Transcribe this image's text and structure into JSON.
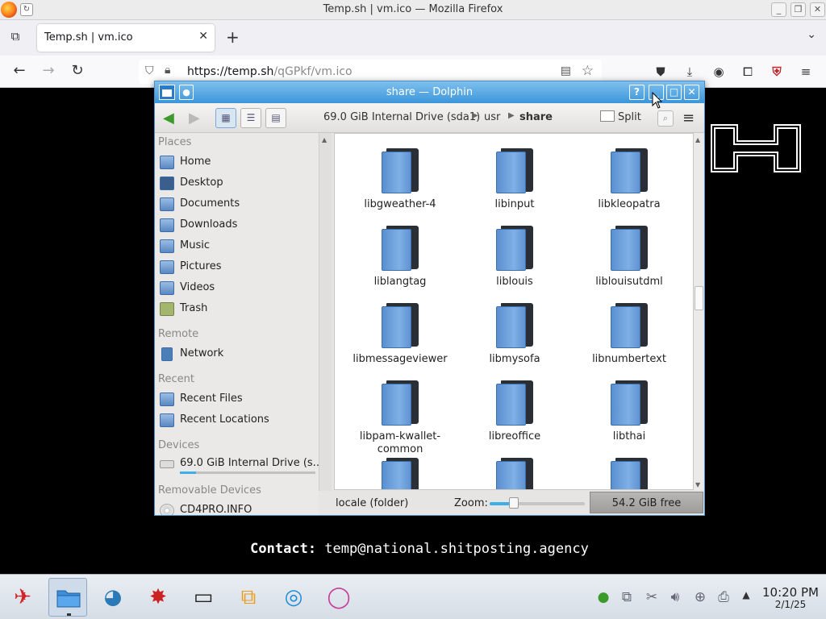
{
  "firefox": {
    "window_title": "Temp.sh | vm.ico — Mozilla Firefox",
    "tab_title": "Temp.sh | vm.ico",
    "url_domain": "https://temp.sh",
    "url_path": "/qGPkf/vm.ico"
  },
  "page": {
    "contact_label": "Contact:",
    "contact_email": "temp@national.shitposting.agency"
  },
  "dolphin": {
    "title": "share — Dolphin",
    "breadcrumbs": [
      "69.0 GiB Internal Drive (sda1)",
      "usr",
      "share"
    ],
    "split_label": "Split",
    "places": {
      "places_header": "Places",
      "home": "Home",
      "desktop": "Desktop",
      "documents": "Documents",
      "downloads": "Downloads",
      "music": "Music",
      "pictures": "Pictures",
      "videos": "Videos",
      "trash": "Trash",
      "remote_header": "Remote",
      "network": "Network",
      "recent_header": "Recent",
      "recent_files": "Recent Files",
      "recent_locations": "Recent Locations",
      "devices_header": "Devices",
      "internal_drive": "69.0 GiB Internal Drive (s...",
      "removable_header": "Removable Devices",
      "cd": "CD4PRO.INFO"
    },
    "files": [
      "libgweather-4",
      "libinput",
      "libkleopatra",
      "liblangtag",
      "liblouis",
      "liblouisutdml",
      "libmessageviewer",
      "libmysofa",
      "libnumbertext",
      "libpam-kwallet-common",
      "libreoffice",
      "libthai"
    ],
    "status": {
      "selection_text": "locale (folder)",
      "zoom_label": "Zoom:",
      "zoom_fraction": 0.25,
      "free_space": "54.2 GiB free"
    }
  },
  "taskbar": {
    "time": "10:20 PM",
    "date": "2/1/25"
  },
  "colors": {
    "dolphin_titlebar": "#3b96da",
    "accent": "#3daee9",
    "folder_blue": "#5a8fd0",
    "page_background": "#000000"
  }
}
